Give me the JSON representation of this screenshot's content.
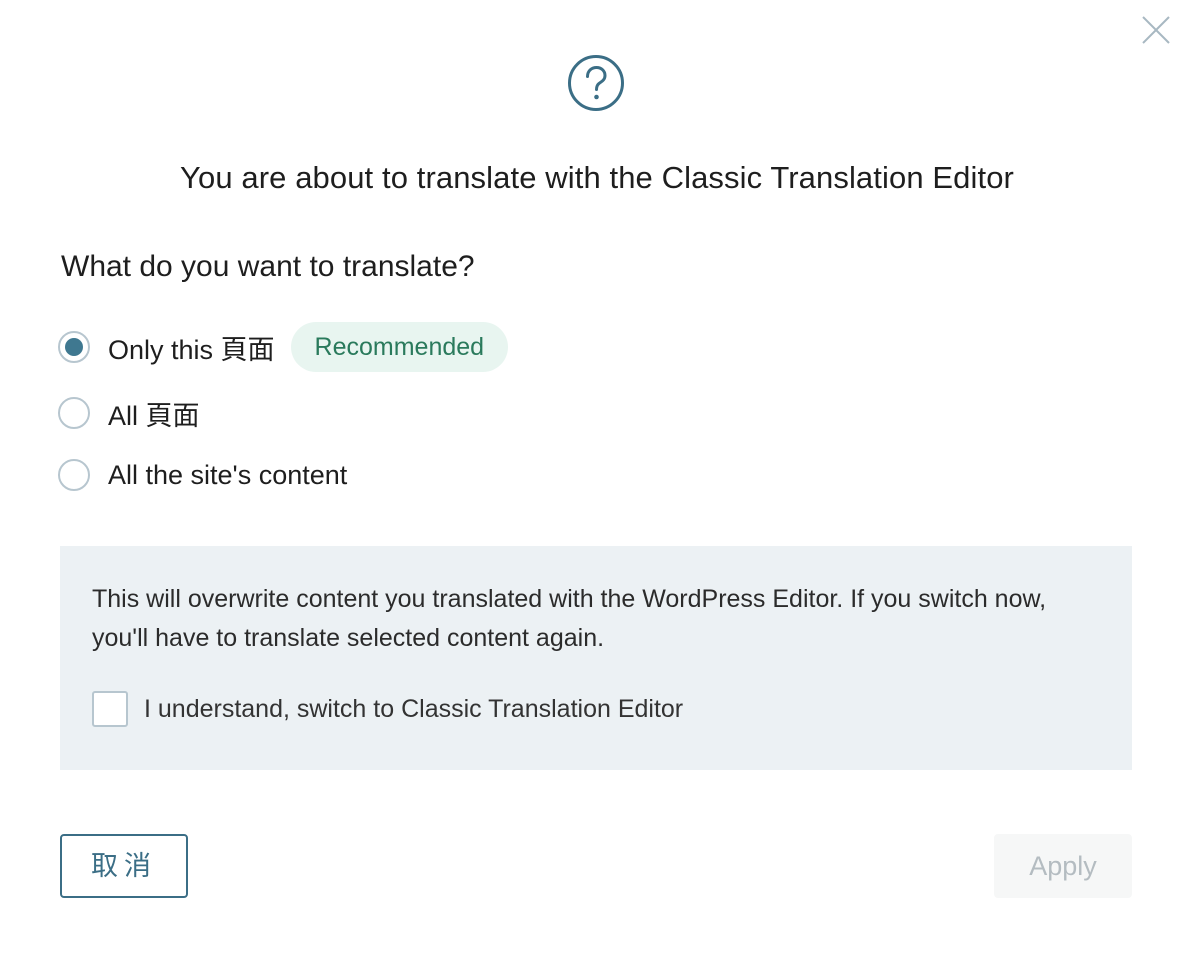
{
  "dialog": {
    "title": "You are about to translate with the Classic Translation Editor",
    "icons": {
      "close": "close-icon",
      "help": "question-circle-icon"
    },
    "colors": {
      "accent": "#3f7890",
      "badge_bg": "#e8f5f0",
      "badge_text": "#2a7a5c",
      "notice_bg": "#ecf1f4",
      "disabled_text": "#b4bcc1"
    }
  },
  "question": "What do you want to translate?",
  "options": [
    {
      "label": "Only this 頁面",
      "checked": true,
      "badge": "Recommended"
    },
    {
      "label": "All 頁面",
      "checked": false
    },
    {
      "label": "All the site's content",
      "checked": false
    }
  ],
  "notice": {
    "text": "This will overwrite content you translated with the WordPress Editor. If you switch now, you'll have to translate selected content again.",
    "confirm_label": "I understand, switch to Classic Translation Editor",
    "confirm_checked": false
  },
  "buttons": {
    "cancel": "取消",
    "apply": "Apply",
    "apply_disabled": true
  }
}
